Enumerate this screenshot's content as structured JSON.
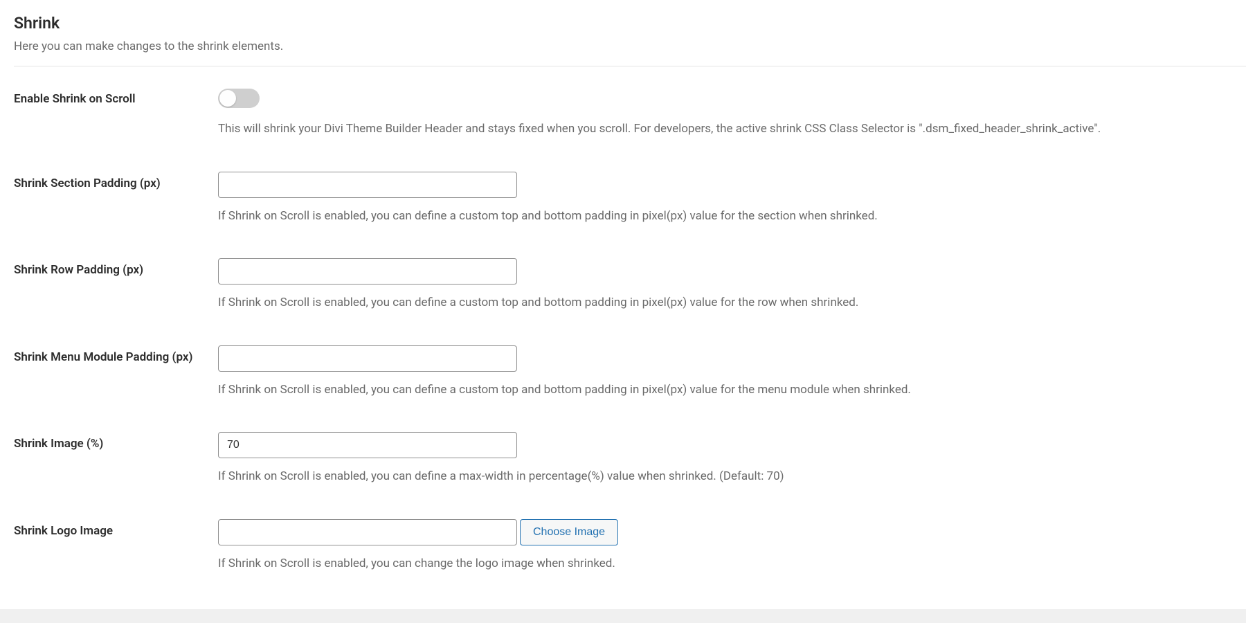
{
  "section": {
    "title": "Shrink",
    "description": "Here you can make changes to the shrink elements."
  },
  "fields": {
    "enable": {
      "label": "Enable Shrink on Scroll",
      "help": "This will shrink your Divi Theme Builder Header and stays fixed when you scroll. For developers, the active shrink CSS Class Selector is \".dsm_fixed_header_shrink_active\".",
      "value": false
    },
    "section_padding": {
      "label": "Shrink Section Padding (px)",
      "help": "If Shrink on Scroll is enabled, you can define a custom top and bottom padding in pixel(px) value for the section when shrinked.",
      "value": ""
    },
    "row_padding": {
      "label": "Shrink Row Padding (px)",
      "help": "If Shrink on Scroll is enabled, you can define a custom top and bottom padding in pixel(px) value for the row when shrinked.",
      "value": ""
    },
    "menu_padding": {
      "label": "Shrink Menu Module Padding (px)",
      "help": "If Shrink on Scroll is enabled, you can define a custom top and bottom padding in pixel(px) value for the menu module when shrinked.",
      "value": ""
    },
    "image_pct": {
      "label": "Shrink Image (%)",
      "help": "If Shrink on Scroll is enabled, you can define a max-width in percentage(%) value when shrinked. (Default: 70)",
      "value": "70"
    },
    "logo_image": {
      "label": "Shrink Logo Image",
      "help": "If Shrink on Scroll is enabled, you can change the logo image when shrinked.",
      "value": "",
      "button": "Choose Image"
    }
  }
}
